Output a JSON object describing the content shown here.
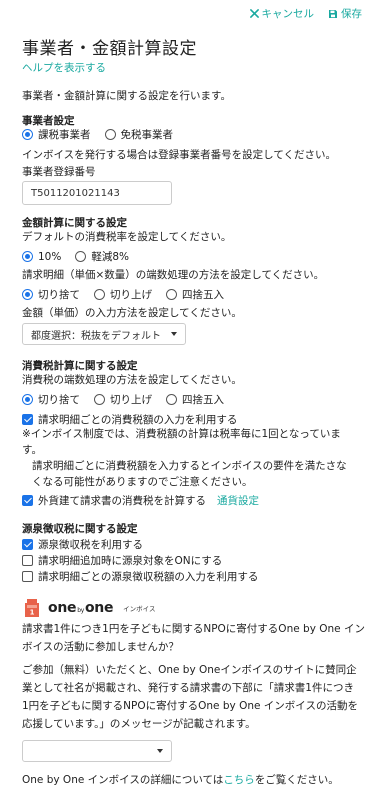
{
  "toolbar": {
    "cancel_label": "キャンセル",
    "save_label": "保存"
  },
  "colors": {
    "accent": "#1aa9a0",
    "control": "#1a73e8",
    "logo": "#e8624a"
  },
  "page": {
    "title": "事業者・金額計算設定",
    "help_link": "ヘルプを表示する",
    "description": "事業者・金額計算に関する設定を行います。"
  },
  "business": {
    "title": "事業者設定",
    "options": [
      "課税事業者",
      "免税事業者"
    ],
    "selected": "課税事業者",
    "invoice_note": "インボイスを発行する場合は登録事業者番号を設定してください。",
    "reg_label": "事業者登録番号",
    "reg_value": "T5011201021143"
  },
  "amount": {
    "title": "金額計算に関する設定",
    "tax_rate_note": "デフォルトの消費税率を設定してください。",
    "tax_rates": [
      "10%",
      "軽減8%"
    ],
    "tax_rate_selected": "10%",
    "rounding_note": "請求明細（単価×数量）の端数処理の方法を設定してください。",
    "rounding_options": [
      "切り捨て",
      "切り上げ",
      "四捨五入"
    ],
    "rounding_selected": "切り捨て",
    "input_method_note": "金額（単価）の入力方法を設定してください。",
    "input_method_value": "都度選択：税抜をデフォルト"
  },
  "consumption_tax": {
    "title": "消費税計算に関する設定",
    "rounding_note": "消費税の端数処理の方法を設定してください。",
    "rounding_options": [
      "切り捨て",
      "切り上げ",
      "四捨五入"
    ],
    "rounding_selected": "切り捨て",
    "per_line_label": "請求明細ごとの消費税額の入力を利用する",
    "per_line_checked": true,
    "warning_1a": "※インボイス制度では、消費税額の計算は税率毎に1回となっていま",
    "warning_1b": "す。",
    "warning_2a": "請求明細ごとに消費税額を入力するとインボイスの要件を満たさな",
    "warning_2b": "くなる可能性がありますのでご注意ください。",
    "foreign_label": "外貨建て請求書の消費税を計算する",
    "foreign_checked": true,
    "currency_link": "通貨設定"
  },
  "withholding": {
    "title": "源泉徴収税に関する設定",
    "items": [
      {
        "label": "源泉徴収税を利用する",
        "checked": true
      },
      {
        "label": "請求明細追加時に源泉対象をONにする",
        "checked": false
      },
      {
        "label": "請求明細ごとの源泉徴収税額の入力を利用する",
        "checked": false
      }
    ]
  },
  "onebyone": {
    "logo_word_1": "one",
    "logo_by": "by",
    "logo_word_2": "one",
    "logo_sub": "インボイス",
    "intro_1": "請求書1件につき1円を子どもに関するNPOに寄付するOne by One イン",
    "intro_2": "ボイスの活動に参加しませんか？",
    "body_1": "ご参加（無料）いただくと、One by Oneインボイスのサイトに賛同企",
    "body_2": "業として社名が掲載され、発行する請求書の下部に「請求書1件につき",
    "body_3": "1円を子どもに関するNPOに寄付するOne by One インボイスの活動を",
    "body_4": "応援しています。」のメッセージが記載されます。",
    "select_value": "",
    "footer_prefix": "One by One インボイスの詳細については",
    "footer_link": "こちら",
    "footer_suffix": "をご覧ください。"
  }
}
